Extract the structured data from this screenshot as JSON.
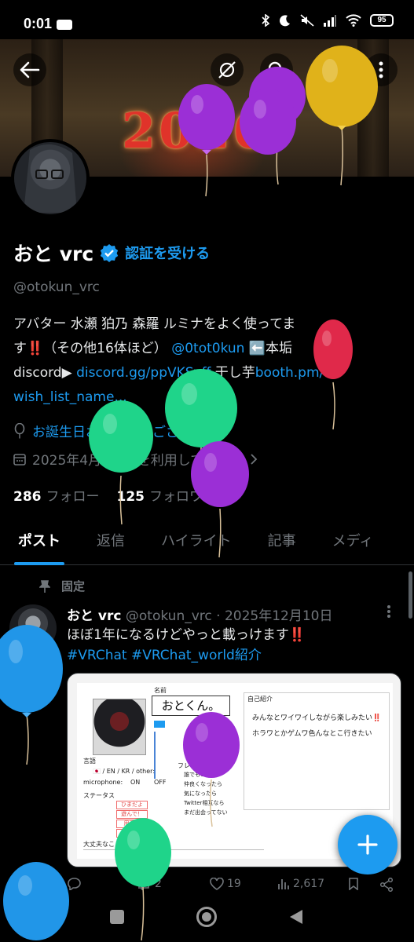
{
  "status_bar": {
    "time": "0:01",
    "battery": "95"
  },
  "banner": {
    "year_text": "2026"
  },
  "profile": {
    "name": "おと vrc",
    "verify_link": "認証を受ける",
    "handle": "@otokun_vrc",
    "bio": {
      "line1": "アバター 水瀬 狛乃 森羅 ルミナをよく使ってま",
      "line2_a": "す",
      "line2_mark": "‼️",
      "line2_b": "（その他16体ほど）",
      "line2_link": "@0tot0kun",
      "line2_c": "⬅️本垢",
      "line3_a": "discord▶",
      "line3_link": "discord.gg/ppVKSvff",
      "line3_b": "干し芋",
      "line3_link2": "booth.pm/",
      "line4_link": "wish_list_name..."
    },
    "birthday": "お誕生日おめでとうございます。",
    "joined": "2025年4月からXを利用しています",
    "following_count": "286",
    "following_label": "フォロー",
    "followers_count": "125",
    "followers_label": "フォロワー"
  },
  "tabs": [
    "ポスト",
    "返信",
    "ハイライト",
    "記事",
    "メディ"
  ],
  "tweet": {
    "pinned_label": "固定",
    "name": "おと vrc",
    "handle_date": "@otokun_vrc · 2025年12月10日",
    "text_line1": "ほぼ1年になるけどやっと載っけます",
    "text_mark": "‼️",
    "text_line2": "#VRChat #VRChat_world紹介",
    "card": {
      "name_label": "名前",
      "name_value": "おとくん。",
      "intro_label": "自己紹介",
      "intro_line1": "みんなとワイワイしながら楽しみたい‼️",
      "intro_line2": "ホラワとかゲムワ色んなとこ行きたい",
      "languages_label": "言語",
      "lang_values": "🇯🇵 / EN / KR / other:",
      "mic_label": "microphone:",
      "mic_on": "ON",
      "mic_off": "OFF",
      "status_label": "ステータス",
      "status_items": [
        "ひまだよ",
        "遊んで！",
        "用事中",
        "話さない"
      ],
      "friend_label": "フレンド申請",
      "friend_items": [
        "誰でもOK",
        "仲良くなったら",
        "気になったら",
        "Twitter相互なら",
        "まだ出会ってない"
      ],
      "boundaries_label": "大丈夫なこと・NGなこと"
    },
    "stats": {
      "reposts": "2",
      "likes": "19",
      "views": "2,617"
    }
  },
  "colors": {
    "accent": "#1d9bf0",
    "muted": "#71767b",
    "background": "#000000",
    "alert": "#f4212e"
  }
}
